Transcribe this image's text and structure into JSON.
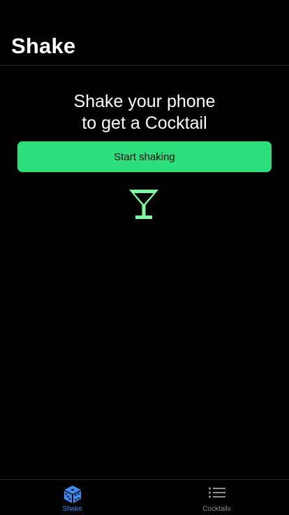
{
  "header": {
    "title": "Shake"
  },
  "main": {
    "headline_line1": "Shake your phone",
    "headline_line2": "to get a Cocktail",
    "start_button_label": "Start shaking",
    "center_icon": "cocktail-glass-icon"
  },
  "tabbar": {
    "tabs": [
      {
        "label": "Shake",
        "icon": "dice-icon",
        "active": true
      },
      {
        "label": "Cocktails",
        "icon": "list-icon",
        "active": false
      }
    ]
  },
  "colors": {
    "background": "#000000",
    "accent_green": "#2ddf7c",
    "icon_green": "#7dfba0",
    "active_tab": "#3f8cf5",
    "inactive_tab": "#8e8e93",
    "divider": "#262626"
  }
}
